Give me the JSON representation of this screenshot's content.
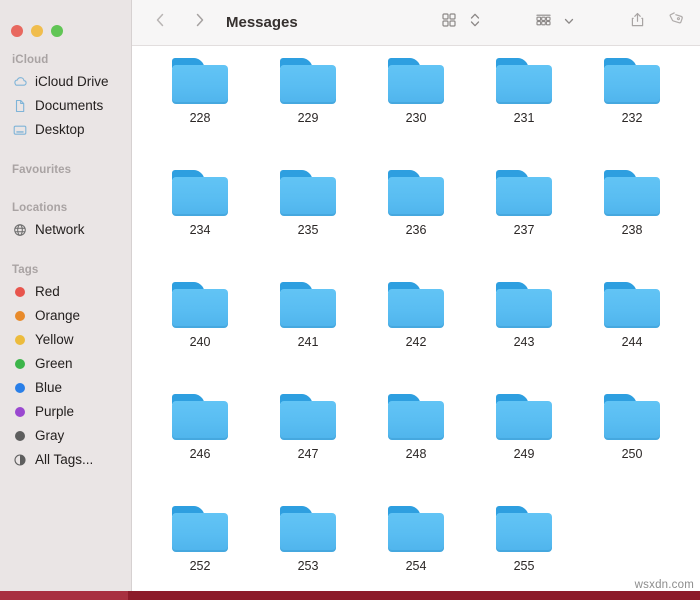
{
  "window": {
    "title": "Messages",
    "traffic_lights": [
      {
        "name": "close",
        "color": "#e8685f"
      },
      {
        "name": "minimize",
        "color": "#f0bd4d"
      },
      {
        "name": "maximize",
        "color": "#61c555"
      }
    ]
  },
  "toolbar": {
    "back_icon": "chevron-left-icon",
    "forward_icon": "chevron-right-icon",
    "view_icon": "icon-view-grid-icon",
    "view_stepper_icon": "chevron-up-down-icon",
    "group_icon": "group-by-grid-icon",
    "group_chevron_icon": "chevron-down-icon",
    "share_icon": "share-icon",
    "tag_icon": "tag-icon"
  },
  "sidebar": {
    "sections": [
      {
        "title": "iCloud",
        "items": [
          {
            "label": "iCloud Drive",
            "icon": "cloud-icon"
          },
          {
            "label": "Documents",
            "icon": "document-icon"
          },
          {
            "label": "Desktop",
            "icon": "desktop-icon"
          }
        ]
      },
      {
        "title": "Favourites",
        "items": []
      },
      {
        "title": "Locations",
        "items": [
          {
            "label": "Network",
            "icon": "globe-icon"
          }
        ]
      },
      {
        "title": "Tags",
        "items": [
          {
            "label": "Red",
            "icon": "tag-dot-icon",
            "color": "#e8554d"
          },
          {
            "label": "Orange",
            "icon": "tag-dot-icon",
            "color": "#e88a2a"
          },
          {
            "label": "Yellow",
            "icon": "tag-dot-icon",
            "color": "#ecbb3c"
          },
          {
            "label": "Green",
            "icon": "tag-dot-icon",
            "color": "#3cb54a"
          },
          {
            "label": "Blue",
            "icon": "tag-dot-icon",
            "color": "#2a7fe8"
          },
          {
            "label": "Purple",
            "icon": "tag-dot-icon",
            "color": "#9a48d0"
          },
          {
            "label": "Gray",
            "icon": "tag-dot-icon",
            "color": "#5e5e5e"
          },
          {
            "label": "All Tags...",
            "icon": "all-tags-icon",
            "color": "#5e5e5e"
          }
        ]
      }
    ]
  },
  "content": {
    "item_type": "folder",
    "folders": [
      "228",
      "229",
      "230",
      "231",
      "232",
      "234",
      "235",
      "236",
      "237",
      "238",
      "240",
      "241",
      "242",
      "243",
      "244",
      "246",
      "247",
      "248",
      "249",
      "250",
      "252",
      "253",
      "254",
      "255"
    ]
  },
  "watermark": {
    "text": "wsxdn.com"
  },
  "colors": {
    "sidebar_bg": "#eae5e5",
    "toolbar_bg": "#f7f6f6",
    "content_bg": "#ffffff",
    "folder_blue": "#59bdf2",
    "folder_tab_blue": "#2e9fe0",
    "bottom_bar": "#8c1b2a"
  }
}
